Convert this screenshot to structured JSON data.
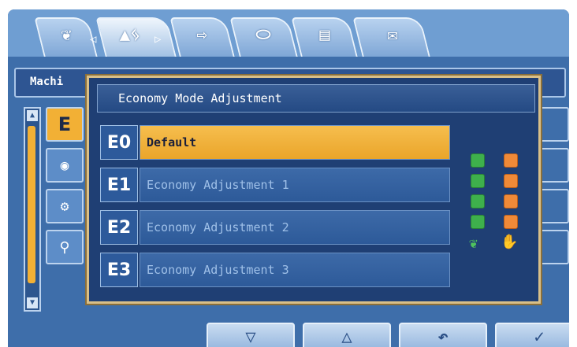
{
  "tabs": [
    {
      "icon": "leaf-icon",
      "glyph": "❦",
      "active": false
    },
    {
      "icon": "operator-mode-icon",
      "glyph": "▲ᛃ",
      "active": true
    },
    {
      "icon": "arrow-right-icon",
      "glyph": "⇨",
      "active": false
    },
    {
      "icon": "engine-icon",
      "glyph": "⬭",
      "active": false
    },
    {
      "icon": "list-icon",
      "glyph": "▤",
      "active": false
    },
    {
      "icon": "mail-icon",
      "glyph": "✉",
      "active": false
    }
  ],
  "tab_nav": {
    "left_glyph": "◁",
    "right_glyph": "▷"
  },
  "page": {
    "title": "Machi"
  },
  "sidebar": {
    "items": [
      {
        "icon": "economy-e-icon",
        "glyph": "E"
      },
      {
        "icon": "gauge-icon",
        "glyph": "◉"
      },
      {
        "icon": "gear-icon",
        "glyph": "⚙"
      },
      {
        "icon": "attachment-icon",
        "glyph": "⚲"
      }
    ],
    "scroll_up": "▲",
    "scroll_down": "▼"
  },
  "popup": {
    "title": "Economy Mode Adjustment",
    "options": [
      {
        "code": "E0",
        "label": "Default",
        "selected": true
      },
      {
        "code": "E1",
        "label": "Economy Adjustment 1",
        "selected": false
      },
      {
        "code": "E2",
        "label": "Economy Adjustment 2",
        "selected": false
      },
      {
        "code": "E3",
        "label": "Economy Adjustment 3",
        "selected": false
      }
    ],
    "indicator": {
      "economy_level": 4,
      "power_level": 4,
      "economy_icon": "leaf-icon",
      "power_icon": "work-power-icon",
      "economy_glyph": "❦",
      "power_glyph": "✋"
    }
  },
  "bottom_buttons": [
    {
      "name": "down-button",
      "icon": "down-triangle-icon",
      "glyph": "▽"
    },
    {
      "name": "up-button",
      "icon": "up-triangle-icon",
      "glyph": "△"
    },
    {
      "name": "back-button",
      "icon": "return-arrow-icon",
      "glyph": "↶"
    },
    {
      "name": "confirm-button",
      "icon": "check-icon",
      "glyph": "✓"
    }
  ],
  "colors": {
    "accent": "#f2b035",
    "selected_row": "#f6be4e",
    "panel": "#1f3f74",
    "economy_square": "#3eb04c",
    "power_square": "#f08a38"
  }
}
